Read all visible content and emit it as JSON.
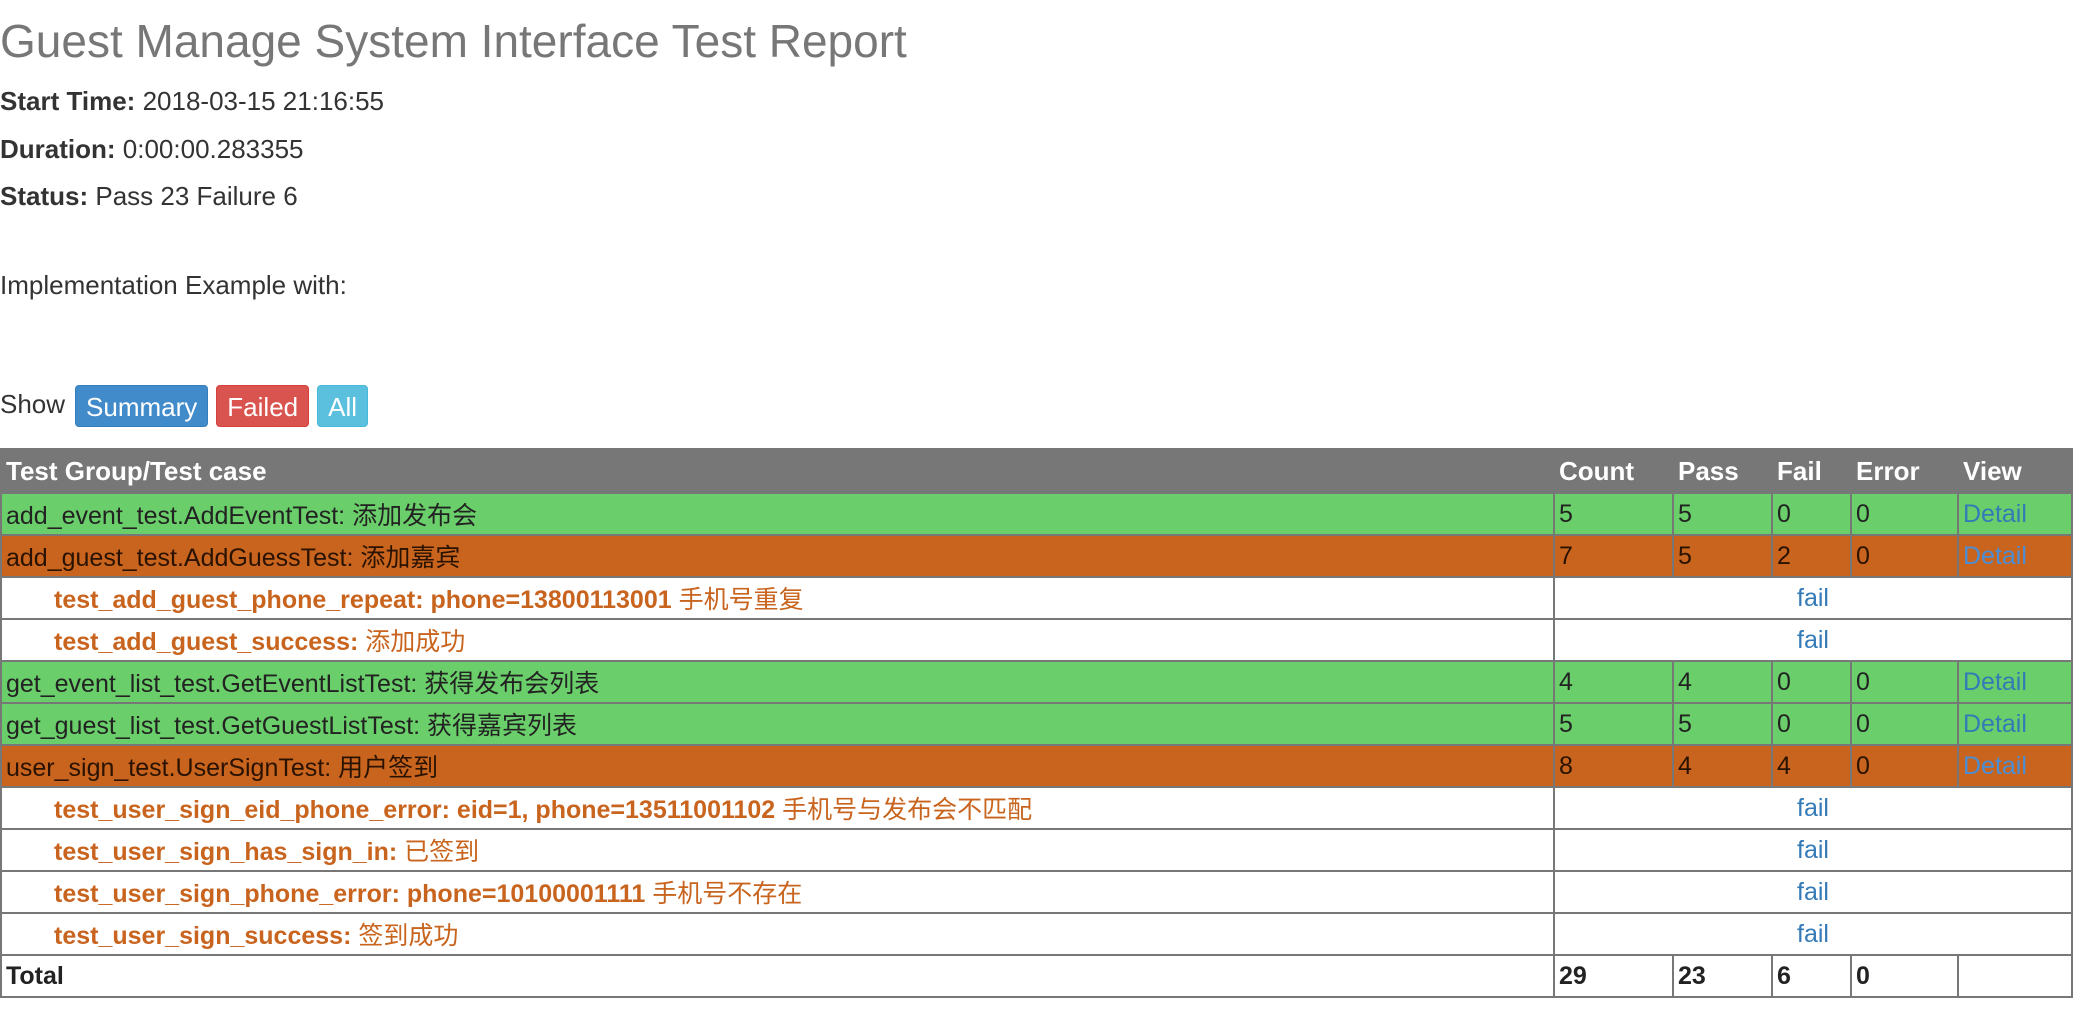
{
  "report": {
    "title": "Guest Manage System Interface Test Report",
    "start_time_label": "Start Time:",
    "start_time": "2018-03-15 21:16:55",
    "duration_label": "Duration:",
    "duration": "0:00:00.283355",
    "status_label": "Status:",
    "status": "Pass 23 Failure 6",
    "description": "Implementation Example with:"
  },
  "filter": {
    "show_label": "Show",
    "summary_label": "Summary",
    "failed_label": "Failed",
    "all_label": "All"
  },
  "table": {
    "headers": [
      "Test Group/Test case",
      "Count",
      "Pass",
      "Fail",
      "Error",
      "View"
    ],
    "groups": [
      {
        "name": "add_event_test.AddEventTest: 添加发布会",
        "count": "5",
        "pass": "5",
        "fail": "0",
        "error": "0",
        "view": "Detail",
        "cases": []
      },
      {
        "name": "add_guest_test.AddGuessTest: 添加嘉宾",
        "count": "7",
        "pass": "5",
        "fail": "2",
        "error": "0",
        "view": "Detail",
        "cases": [
          {
            "name": "test_add_guest_phone_repeat: phone=13800113001",
            "desc": "手机号重复",
            "status": "fail"
          },
          {
            "name": "test_add_guest_success:",
            "desc": "添加成功",
            "status": "fail"
          }
        ]
      },
      {
        "name": "get_event_list_test.GetEventListTest: 获得发布会列表",
        "count": "4",
        "pass": "4",
        "fail": "0",
        "error": "0",
        "view": "Detail",
        "cases": []
      },
      {
        "name": "get_guest_list_test.GetGuestListTest: 获得嘉宾列表",
        "count": "5",
        "pass": "5",
        "fail": "0",
        "error": "0",
        "view": "Detail",
        "cases": []
      },
      {
        "name": "user_sign_test.UserSignTest: 用户签到",
        "count": "8",
        "pass": "4",
        "fail": "4",
        "error": "0",
        "view": "Detail",
        "cases": [
          {
            "name": "test_user_sign_eid_phone_error: eid=1, phone=13511001102",
            "desc": "手机号与发布会不匹配",
            "status": "fail"
          },
          {
            "name": "test_user_sign_has_sign_in:",
            "desc": "已签到",
            "status": "fail"
          },
          {
            "name": "test_user_sign_phone_error: phone=10100001111",
            "desc": "手机号不存在",
            "status": "fail"
          },
          {
            "name": "test_user_sign_success:",
            "desc": "签到成功",
            "status": "fail"
          }
        ]
      }
    ],
    "total": {
      "label": "Total",
      "count": "29",
      "pass": "23",
      "fail": "6",
      "error": "0"
    }
  },
  "colors": {
    "pass_row": "#6acf6a",
    "fail_row": "#c8641e",
    "header": "#777777",
    "link": "#337ab7"
  }
}
